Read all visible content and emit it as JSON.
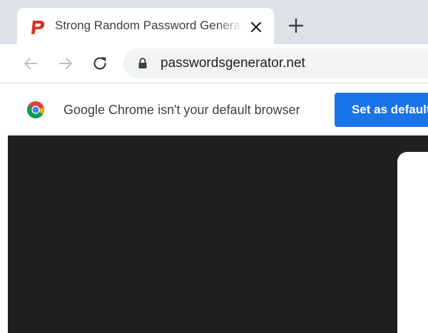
{
  "tab": {
    "title": "Strong Random Password Generator",
    "favicon": "passwordsgenerator-favicon",
    "favicon_color": "#d93025",
    "close_icon": "close-icon"
  },
  "new_tab_icon": "plus-icon",
  "toolbar": {
    "back_icon": "arrow-left-icon",
    "forward_icon": "arrow-right-icon",
    "reload_icon": "reload-icon",
    "lock_icon": "lock-icon",
    "url": "passwordsgenerator.net"
  },
  "infobar": {
    "logo": "chrome-logo-icon",
    "message": "Google Chrome isn't your default browser",
    "button_label": "Set as default",
    "button_color": "#1a73e8"
  },
  "content": {
    "background_color": "#202020",
    "card_color": "#ffffff"
  }
}
